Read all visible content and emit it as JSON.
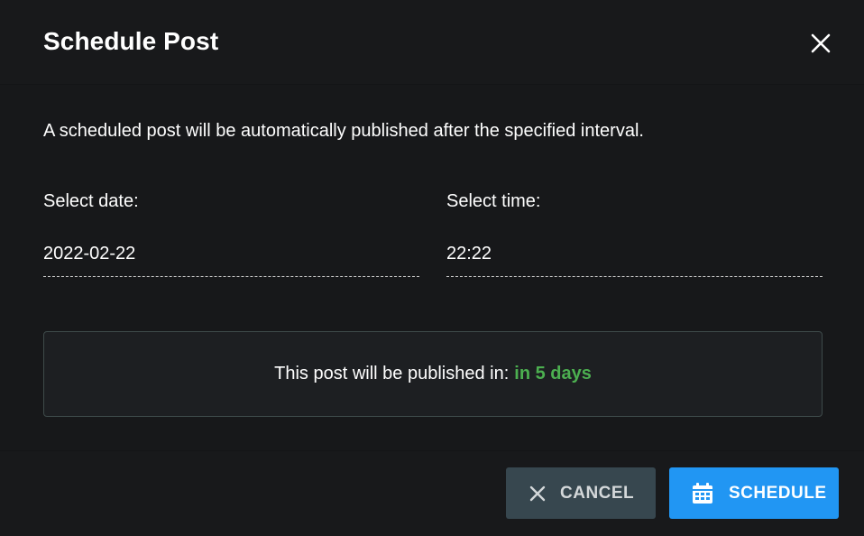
{
  "dialog": {
    "title": "Schedule Post",
    "close_icon": "close-icon"
  },
  "body": {
    "description": "A scheduled post will be automatically published after the specified interval.",
    "date": {
      "label": "Select date:",
      "value": "2022-02-22"
    },
    "time": {
      "label": "Select time:",
      "value": "22:22"
    },
    "publish_info": {
      "prefix": "This post will be published in:",
      "value": "in 5 days",
      "value_color": "#4caf50"
    }
  },
  "footer": {
    "cancel": {
      "label": "CANCEL",
      "icon": "close-icon",
      "color": "#37474f"
    },
    "schedule": {
      "label": "SCHEDULE",
      "icon": "calendar-icon",
      "color": "#2196f3"
    }
  }
}
